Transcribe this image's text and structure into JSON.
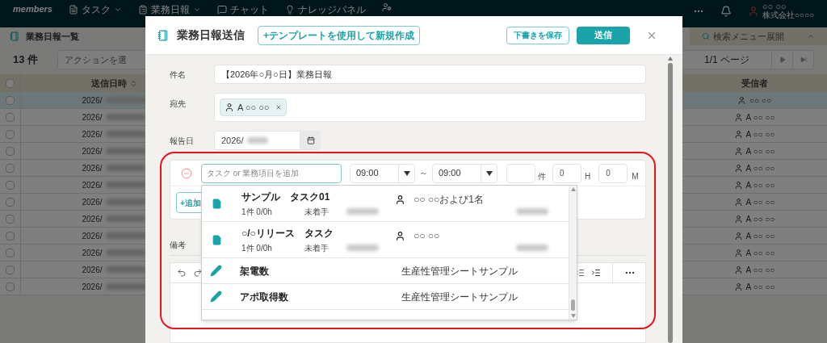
{
  "nav": {
    "logo": "members",
    "items": [
      {
        "label": "タスク",
        "caret": true
      },
      {
        "label": "業務日報",
        "caret": true
      },
      {
        "label": "チャット",
        "caret": false
      },
      {
        "label": "ナレッジパネル",
        "caret": false
      }
    ],
    "user": {
      "name": "○○ ○○",
      "company": "株式会社○○○○"
    }
  },
  "list_page": {
    "title": "業務日報一覧",
    "count": "13 件",
    "action_select": "アクションを選",
    "search_toggle": "検索メニュー展開",
    "pagination": "1/1 ページ",
    "columns": [
      "送信日時",
      "受信者"
    ],
    "select_all_checked": false,
    "rows": [
      {
        "sent": "2026/",
        "recipient": "○○ ○○",
        "selected": true,
        "checked": false
      },
      {
        "sent": "2026/",
        "recipient": "A ○○ ○○",
        "selected": false,
        "checked": false
      },
      {
        "sent": "2026/",
        "recipient": "A ○○ ○○",
        "selected": false,
        "checked": false
      },
      {
        "sent": "2026/",
        "recipient": "A ○○ ○○",
        "selected": false,
        "checked": false
      },
      {
        "sent": "2026/",
        "recipient": "A ○○ ○○",
        "selected": false,
        "checked": false
      },
      {
        "sent": "2026/",
        "recipient": "A ○○ ○○",
        "selected": false,
        "checked": false
      },
      {
        "sent": "2026/",
        "recipient": "A ○○ ○○",
        "selected": false,
        "checked": false
      },
      {
        "sent": "2026/",
        "recipient": "A ○○ ○○",
        "selected": false,
        "checked": false
      },
      {
        "sent": "2026/",
        "recipient": "A ○○ ○○",
        "selected": false,
        "checked": false
      },
      {
        "sent": "2026/",
        "recipient": "A ○○ ○○",
        "selected": false,
        "checked": false
      },
      {
        "sent": "2026/",
        "recipient": "A ○○ ○○",
        "selected": false,
        "checked": false
      },
      {
        "sent": "2026/",
        "recipient": "A ○○ ○○",
        "selected": false,
        "checked": false
      }
    ]
  },
  "dialog": {
    "title": "業務日報送信",
    "template_button": "+テンプレートを使用して新規作成",
    "save_draft": "下書きを保存",
    "send": "送信",
    "subject": {
      "label": "件名",
      "value": "【2026年○月○日】業務日報"
    },
    "to": {
      "label": "宛先",
      "chips": [
        "A ○○ ○○"
      ]
    },
    "report_date": {
      "label": "報告日",
      "value": "2026/"
    },
    "entry": {
      "placeholder": "タスク or 業務項目を追加",
      "start": "09:00",
      "separator": "～",
      "end": "09:00",
      "count_unit": "件",
      "hours": "0",
      "hours_unit": "H",
      "minutes": "0",
      "minutes_unit": "M",
      "add_button": "+追加"
    },
    "dropdown": [
      {
        "kind": "task",
        "title": "サンプル　タスク01",
        "stats": "1件 0/0h",
        "status": "未着手",
        "assignee": "○○ ○○および1名"
      },
      {
        "kind": "task",
        "title": "○/○リリース　タスク",
        "stats": "1件 0/0h",
        "status": "未着手",
        "assignee": "○○ ○○"
      },
      {
        "kind": "item",
        "title": "架電数",
        "sheet": "生産性管理シートサンプル"
      },
      {
        "kind": "item",
        "title": "アポ取得数",
        "sheet": "生産性管理シートサンプル"
      }
    ],
    "notes_label": "備考"
  }
}
